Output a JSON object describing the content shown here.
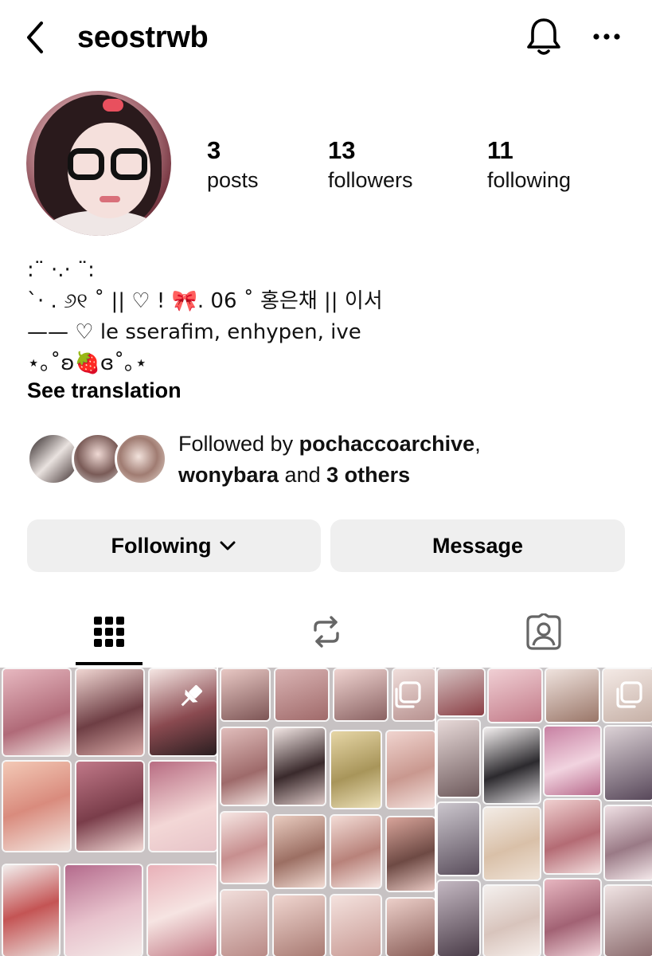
{
  "header": {
    "username": "seostrwb"
  },
  "stats": {
    "posts": {
      "count": "3",
      "label": "posts"
    },
    "followers": {
      "count": "13",
      "label": "followers"
    },
    "following": {
      "count": "11",
      "label": "following"
    }
  },
  "bio": {
    "lines": [
      ":¨ ·.· ¨:",
      "`· . ୬୧ ˚ || ♡ ! 🎀. 06 ˚ 홍은채 || 이서",
      "—— ♡ le sserafim, enhypen, ive",
      "⋆｡˚ʚ🍓ɞ˚｡⋆"
    ],
    "see_translation": "See translation"
  },
  "followed_by": {
    "prefix": "Followed by ",
    "user1": "pochaccoarchive",
    "separator": ",",
    "user2": "wonybara",
    "conjunction": " and ",
    "others": "3 others"
  },
  "buttons": {
    "following_label": "Following",
    "message_label": "Message"
  },
  "tabs": [
    {
      "icon": "grid-icon",
      "active": true
    },
    {
      "icon": "reels-repost-icon",
      "active": false
    },
    {
      "icon": "tagged-icon",
      "active": false
    }
  ],
  "posts": [
    {
      "badge": "pin-icon"
    },
    {
      "badge": "carousel-icon"
    },
    {
      "badge": "carousel-icon"
    }
  ],
  "colors": {
    "button_bg": "#efefef",
    "text": "#000000",
    "background": "#ffffff"
  }
}
